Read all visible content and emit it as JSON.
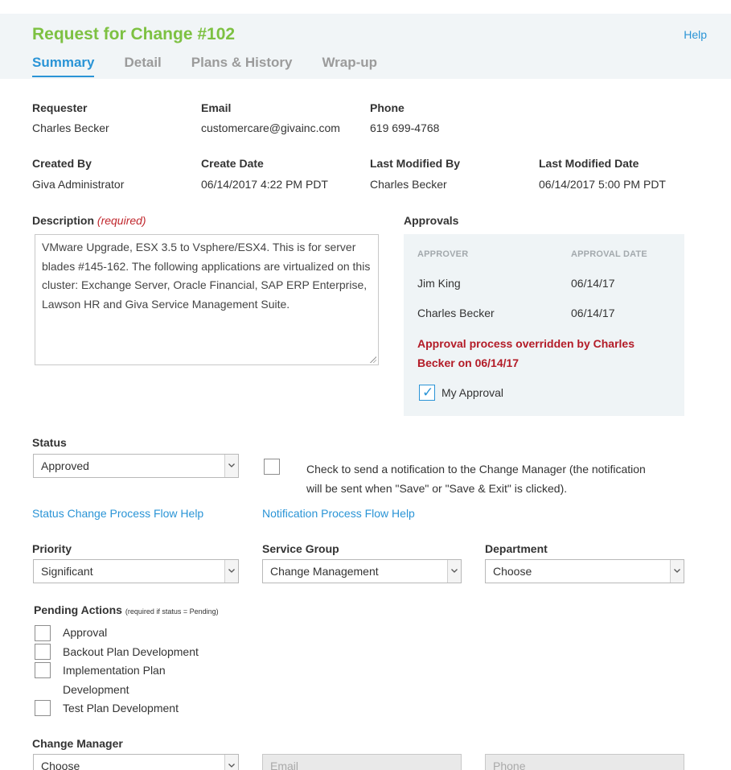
{
  "header": {
    "title": "Request for Change #102",
    "help": "Help",
    "tabs": [
      {
        "label": "Summary",
        "active": true
      },
      {
        "label": "Detail",
        "active": false
      },
      {
        "label": "Plans & History",
        "active": false
      },
      {
        "label": "Wrap-up",
        "active": false
      }
    ]
  },
  "info": {
    "requester_label": "Requester",
    "requester": "Charles Becker",
    "email_label": "Email",
    "email": "customercare@givainc.com",
    "phone_label": "Phone",
    "phone": "619 699-4768",
    "created_by_label": "Created By",
    "created_by": "Giva Administrator",
    "create_date_label": "Create Date",
    "create_date": "06/14/2017 4:22 PM PDT",
    "last_modified_by_label": "Last Modified By",
    "last_modified_by": "Charles Becker",
    "last_modified_date_label": "Last Modified Date",
    "last_modified_date": "06/14/2017 5:00 PM PDT"
  },
  "description": {
    "label": "Description",
    "required": "(required)",
    "text": "VMware Upgrade, ESX 3.5 to Vsphere/ESX4. This is for server blades #145-162. The following applications are virtualized on this cluster: Exchange Server, Oracle Financial, SAP ERP Enterprise, Lawson HR and Giva Service Management Suite."
  },
  "approvals": {
    "label": "Approvals",
    "col_approver": "APPROVER",
    "col_date": "APPROVAL DATE",
    "rows": [
      {
        "approver": "Jim King",
        "date": "06/14/17"
      },
      {
        "approver": "Charles Becker",
        "date": "06/14/17"
      }
    ],
    "override_text": "Approval process overridden by Charles Becker on 06/14/17",
    "my_approval_label": "My Approval",
    "my_approval_checked": true
  },
  "status": {
    "label": "Status",
    "selected": "Approved",
    "notify_text": "Check to send a notification to the Change Manager (the notification will be sent when \"Save\" or \"Save & Exit\" is clicked).",
    "status_help_link": "Status Change Process Flow Help",
    "notification_help_link": "Notification Process Flow Help"
  },
  "priority": {
    "label": "Priority",
    "selected": "Significant"
  },
  "service_group": {
    "label": "Service Group",
    "selected": "Change Management"
  },
  "department": {
    "label": "Department",
    "selected": "Choose"
  },
  "pending_actions": {
    "label": "Pending Actions",
    "note": "(required if status = Pending)",
    "items": [
      "Approval",
      "Backout Plan Development",
      "Implementation Plan Development",
      "Test Plan Development"
    ]
  },
  "change_manager": {
    "label": "Change Manager",
    "selected": "Choose",
    "email_placeholder": "Email",
    "phone_placeholder": "Phone"
  },
  "colors": {
    "title_green": "#7dc142",
    "link_blue": "#2a94d6",
    "alert_red": "#b31b27",
    "panel_bg": "#eff4f6"
  }
}
